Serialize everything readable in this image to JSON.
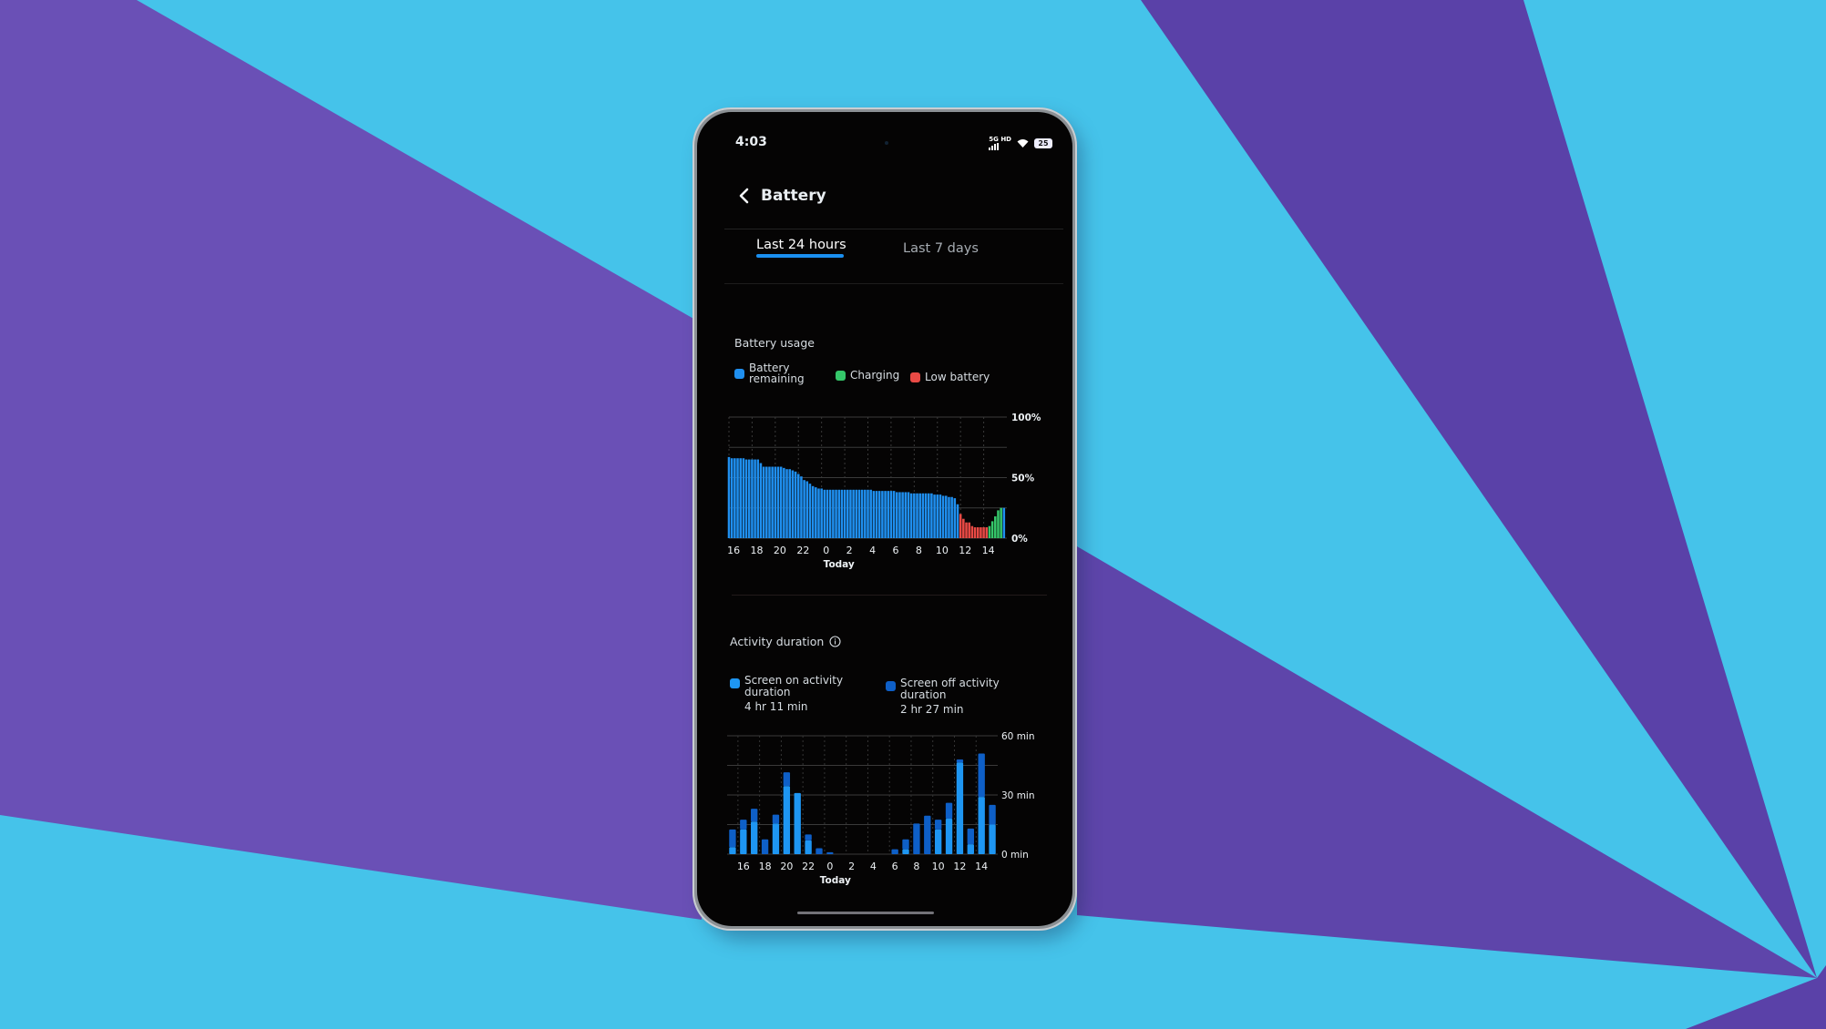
{
  "status_bar": {
    "time": "4:03",
    "network": "5G HD",
    "battery_level": "25",
    "icons": [
      "signal-icon",
      "wifi-icon",
      "battery-icon"
    ]
  },
  "header": {
    "back_icon": "chevron-left-icon",
    "title": "Battery"
  },
  "tabs": [
    {
      "label": "Last 24 hours",
      "active": true
    },
    {
      "label": "Last 7 days",
      "active": false
    }
  ],
  "colors": {
    "accent": "#1a8ff0",
    "battery_remaining": "#1f8fef",
    "charging": "#35c76a",
    "low_battery": "#e94a45",
    "screen_on": "#1e96f2",
    "screen_off": "#0e5fc7",
    "background_purple": "#6b4fb8",
    "background_cyan": "#45c3ea"
  },
  "battery_usage": {
    "title": "Battery usage",
    "legend": [
      {
        "label_line1": "Battery",
        "label_line2": "remaining",
        "color_key": "battery_remaining"
      },
      {
        "label_line1": "Charging",
        "label_line2": "",
        "color_key": "charging"
      },
      {
        "label_line1": "Low battery",
        "label_line2": "",
        "color_key": "low_battery"
      }
    ]
  },
  "activity_duration": {
    "title": "Activity duration",
    "info_icon": "info-icon",
    "legend": [
      {
        "label_line1": "Screen on activity",
        "label_line2": "duration",
        "value": "4 hr 11 min",
        "color_key": "screen_on"
      },
      {
        "label_line1": "Screen off activity",
        "label_line2": "duration",
        "value": "2 hr 27 min",
        "color_key": "screen_off"
      }
    ]
  },
  "chart_data": [
    {
      "type": "bar",
      "title": "Battery usage",
      "xlabel": "",
      "ylabel": "",
      "ylim": [
        0,
        100
      ],
      "y_ticks": [
        "0%",
        "50%",
        "100%"
      ],
      "x_tick_labels": [
        "16",
        "18",
        "20",
        "22",
        "0",
        "2",
        "4",
        "6",
        "8",
        "10",
        "12",
        "14"
      ],
      "x_sublabel": {
        "under": "0",
        "text": "Today"
      },
      "grid": true,
      "legend_position": "top",
      "x_range_hours": [
        15.5,
        39.5
      ],
      "series": [
        {
          "name": "Battery remaining",
          "color_key": "battery_remaining",
          "x": [
            15.5,
            15.75,
            16,
            16.25,
            16.5,
            16.75,
            17,
            17.25,
            17.5,
            17.75,
            18,
            18.25,
            18.5,
            18.75,
            19,
            19.25,
            19.5,
            19.75,
            20,
            20.25,
            20.5,
            20.75,
            21,
            21.25,
            21.5,
            21.75,
            22,
            22.25,
            22.5,
            22.75,
            23,
            23.25,
            23.5,
            23.75,
            24,
            24.25,
            24.5,
            24.75,
            25,
            25.25,
            25.5,
            25.75,
            26,
            26.25,
            26.5,
            26.75,
            27,
            27.25,
            27.5,
            27.75,
            28,
            28.25,
            28.5,
            28.75,
            29,
            29.25,
            29.5,
            29.75,
            30,
            30.25,
            30.5,
            30.75,
            31,
            31.25,
            31.5,
            31.75,
            32,
            32.25,
            32.5,
            32.75,
            33,
            33.25,
            33.5,
            33.75,
            34,
            34.25,
            34.5,
            34.75,
            35,
            35.25
          ],
          "values": [
            67,
            66,
            66,
            66,
            66,
            66,
            65,
            65,
            65,
            65,
            65,
            62,
            59,
            59,
            59,
            59,
            59,
            59,
            59,
            58,
            57,
            57,
            56,
            55,
            53,
            51,
            48,
            47,
            45,
            43,
            42,
            41,
            41,
            40,
            40,
            40,
            40,
            40,
            40,
            40,
            40,
            40,
            40,
            40,
            40,
            40,
            40,
            40,
            40,
            40,
            39,
            39,
            39,
            39,
            39,
            39,
            39,
            39,
            38,
            38,
            38,
            38,
            38,
            37,
            37,
            37,
            37,
            37,
            37,
            37,
            37,
            36,
            36,
            36,
            35,
            35,
            34,
            34,
            33,
            28
          ]
        },
        {
          "name": "Low battery",
          "color_key": "low_battery",
          "x": [
            35.5,
            35.75,
            36,
            36.25,
            36.5,
            36.75,
            37,
            37.25,
            37.5,
            37.75
          ],
          "values": [
            20,
            16,
            13,
            13,
            10,
            9,
            9,
            9,
            9,
            9
          ]
        },
        {
          "name": "Charging",
          "color_key": "charging",
          "x": [
            38,
            38.25,
            38.5,
            38.75,
            39
          ],
          "values": [
            10,
            14,
            18,
            23,
            25
          ]
        },
        {
          "name": "Battery remaining (current)",
          "color_key": "battery_remaining",
          "x": [
            39.25
          ],
          "values": [
            25
          ]
        }
      ]
    },
    {
      "type": "bar",
      "title": "Activity duration",
      "xlabel": "",
      "ylabel": "",
      "ylim": [
        0,
        60
      ],
      "y_ticks": [
        "0 min",
        "30 min",
        "60 min"
      ],
      "x_tick_labels": [
        "16",
        "18",
        "20",
        "22",
        "0",
        "2",
        "4",
        "6",
        "8",
        "10",
        "12",
        "14"
      ],
      "x_sublabel": {
        "under": "0",
        "text": "Today"
      },
      "grid": true,
      "stacked": true,
      "categories": [
        "15",
        "16",
        "17",
        "18",
        "19",
        "20",
        "21",
        "22",
        "23",
        "0",
        "1",
        "2",
        "3",
        "4",
        "5",
        "6",
        "7",
        "8",
        "9",
        "10",
        "11",
        "12",
        "13",
        "14",
        "15"
      ],
      "series": [
        {
          "name": "Screen on activity duration",
          "color_key": "screen_on",
          "values": [
            3.5,
            12.5,
            16.5,
            0,
            15.5,
            34.5,
            31,
            7,
            0,
            0,
            0,
            0,
            0,
            0,
            0,
            0,
            2.5,
            0,
            0,
            12.5,
            18,
            46.5,
            5,
            29,
            15
          ]
        },
        {
          "name": "Screen off activity duration",
          "color_key": "screen_off",
          "values": [
            9,
            5,
            6.5,
            7.5,
            4.5,
            7,
            0,
            3,
            3,
            1,
            0,
            0,
            0,
            0,
            0,
            2.5,
            5,
            15.5,
            19.5,
            5,
            8,
            1.5,
            8,
            22,
            10
          ]
        }
      ]
    }
  ]
}
